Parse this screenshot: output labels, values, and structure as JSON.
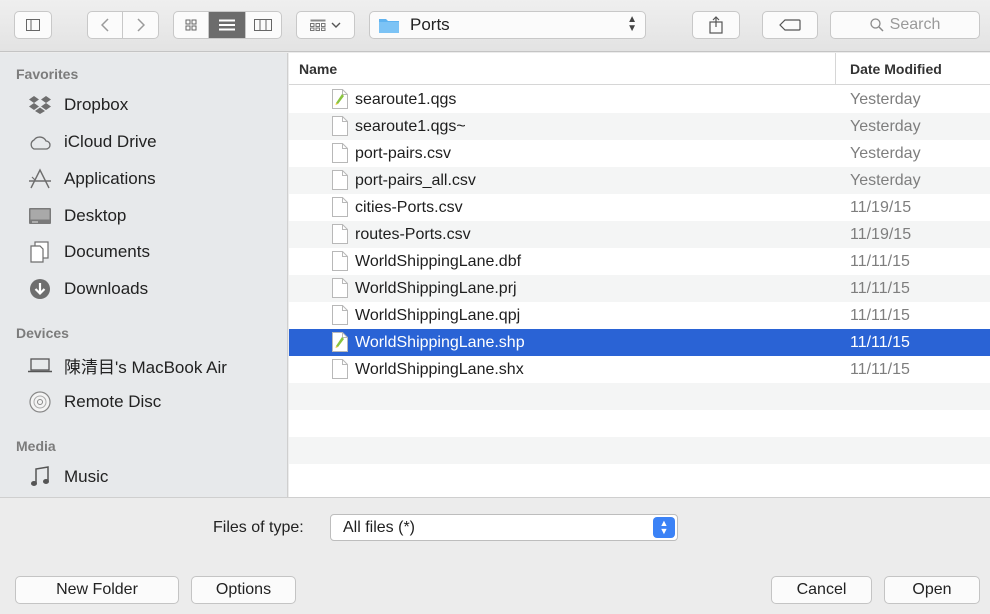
{
  "toolbar": {
    "sidebar_toggle_icon": "sidebar-icon",
    "back_icon": "chevron-left-icon",
    "forward_icon": "chevron-right-icon",
    "view_icons": [
      "icon-view-icon",
      "list-view-icon",
      "column-view-icon"
    ],
    "arrange_icon": "arrange-icon",
    "location": "Ports",
    "share_icon": "share-icon",
    "tag_icon": "tag-icon",
    "search_placeholder": "Search"
  },
  "sidebar": {
    "favorites_label": "Favorites",
    "favorites": [
      {
        "label": "Dropbox",
        "icon": "dropbox-icon"
      },
      {
        "label": "iCloud Drive",
        "icon": "cloud-icon"
      },
      {
        "label": "Applications",
        "icon": "applications-icon"
      },
      {
        "label": "Desktop",
        "icon": "desktop-icon"
      },
      {
        "label": "Documents",
        "icon": "documents-icon"
      },
      {
        "label": "Downloads",
        "icon": "downloads-icon"
      }
    ],
    "devices_label": "Devices",
    "devices": [
      {
        "label": "陳清目's MacBook Air",
        "icon": "laptop-icon"
      },
      {
        "label": "Remote Disc",
        "icon": "disc-icon"
      }
    ],
    "media_label": "Media",
    "media": [
      {
        "label": "Music",
        "icon": "music-icon"
      }
    ]
  },
  "filelist": {
    "columns": {
      "name": "Name",
      "date": "Date Modified"
    },
    "files": [
      {
        "name": "searoute1.qgs",
        "date": "Yesterday",
        "icon": "qgis-file-icon"
      },
      {
        "name": "searoute1.qgs~",
        "date": "Yesterday",
        "icon": "file-icon"
      },
      {
        "name": "port-pairs.csv",
        "date": "Yesterday",
        "icon": "file-icon"
      },
      {
        "name": "port-pairs_all.csv",
        "date": "Yesterday",
        "icon": "file-icon"
      },
      {
        "name": "cities-Ports.csv",
        "date": "11/19/15",
        "icon": "file-icon"
      },
      {
        "name": "routes-Ports.csv",
        "date": "11/19/15",
        "icon": "file-icon"
      },
      {
        "name": "WorldShippingLane.dbf",
        "date": "11/11/15",
        "icon": "file-icon"
      },
      {
        "name": "WorldShippingLane.prj",
        "date": "11/11/15",
        "icon": "file-icon"
      },
      {
        "name": "WorldShippingLane.qpj",
        "date": "11/11/15",
        "icon": "file-icon"
      },
      {
        "name": "WorldShippingLane.shp",
        "date": "11/11/15",
        "icon": "qgis-file-icon",
        "selected": true
      },
      {
        "name": "WorldShippingLane.shx",
        "date": "11/11/15",
        "icon": "file-icon"
      }
    ]
  },
  "bottom": {
    "files_of_type_label": "Files of type:",
    "files_of_type_value": "All files (*)",
    "new_folder": "New Folder",
    "options": "Options",
    "cancel": "Cancel",
    "open": "Open"
  },
  "colors": {
    "selection": "#2a63d5",
    "sidebar_bg": "#e7e9eb",
    "toolbar_bg": "#e8e8e8",
    "stepper_blue": "#3b82f6"
  }
}
